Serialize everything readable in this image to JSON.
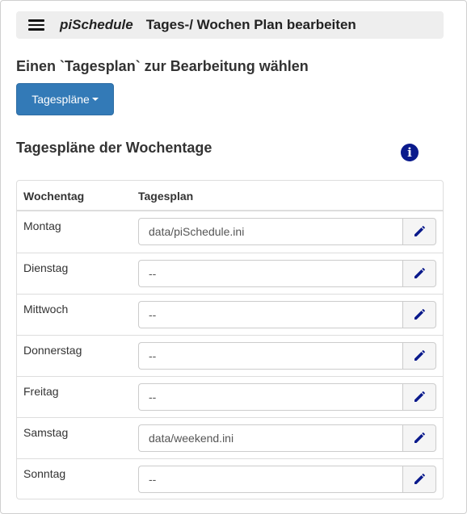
{
  "navbar": {
    "brand": "piSchedule",
    "title": "Tages-/ Wochen Plan bearbeiten"
  },
  "choose": {
    "heading": "Einen `Tagesplan` zur Bearbeitung wählen",
    "dropdown_label": "Tagespläne"
  },
  "week": {
    "heading": "Tagespläne der Wochentage",
    "info_icon": "info-icon"
  },
  "table": {
    "headers": {
      "day": "Wochentag",
      "plan": "Tagesplan"
    },
    "rows": [
      {
        "day": "Montag",
        "plan": "data/piSchedule.ini"
      },
      {
        "day": "Dienstag",
        "plan": "--"
      },
      {
        "day": "Mittwoch",
        "plan": "--"
      },
      {
        "day": "Donnerstag",
        "plan": "--"
      },
      {
        "day": "Freitag",
        "plan": "--"
      },
      {
        "day": "Samstag",
        "plan": "data/weekend.ini"
      },
      {
        "day": "Sonntag",
        "plan": "--"
      }
    ],
    "edit_icon": "pencil-icon"
  },
  "colors": {
    "primary": "#337ab7",
    "icon": "#0a1a8c",
    "navbar_bg": "#eeeeee"
  }
}
